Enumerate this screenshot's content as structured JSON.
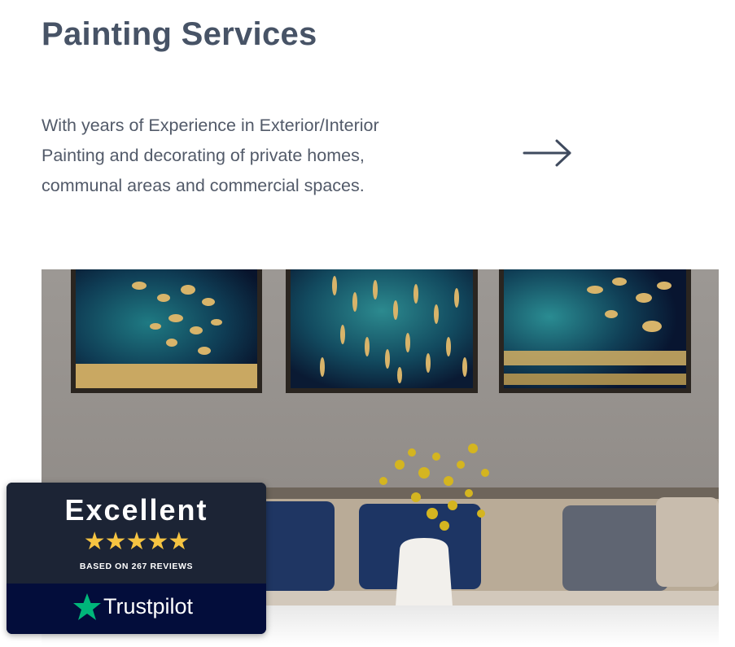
{
  "section": {
    "title": "Painting Services",
    "description_lines": [
      "With years of Experience in Exterior/Interior",
      "Painting and decorating of private homes,",
      "communal areas and commercial spaces."
    ],
    "arrow_icon": "arrow-right-icon"
  },
  "badge": {
    "rating_label": "Excellent",
    "stars": "★★★★★",
    "star_count": 5,
    "reviews_text": "BASED ON 267 REVIEWS",
    "brand": "Trustpilot",
    "brand_icon": "trustpilot-star-icon",
    "colors": {
      "star_gold": "#f6c442",
      "trustpilot_green": "#00b67a",
      "bottom_bg": "#030d3b"
    }
  },
  "colors": {
    "title": "#475366",
    "text": "#525a69"
  }
}
